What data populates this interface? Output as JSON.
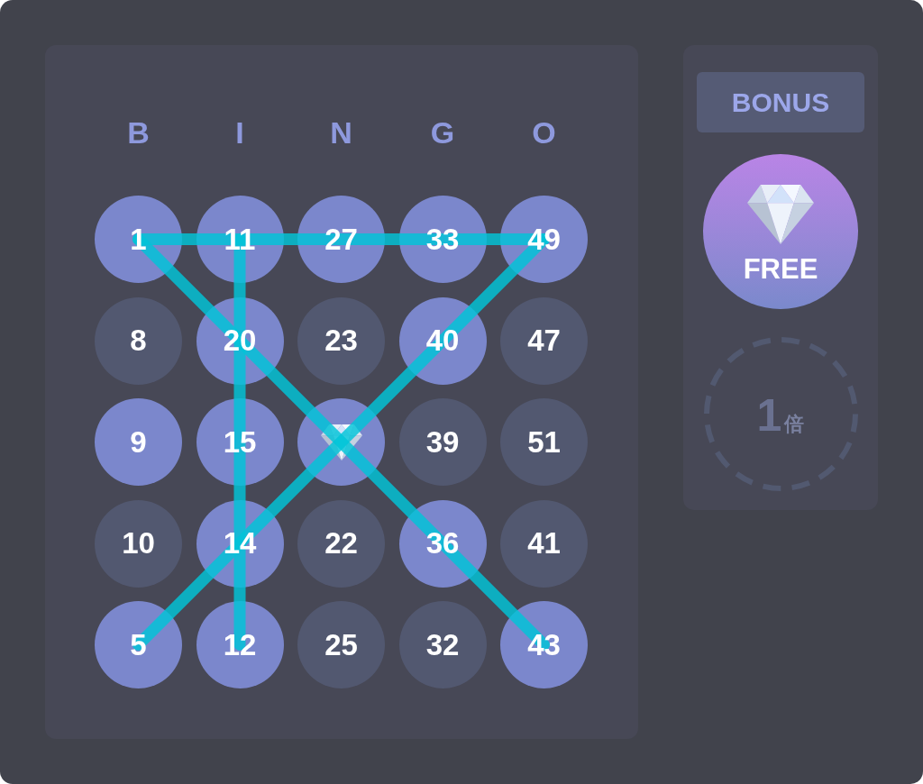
{
  "card": {
    "headers": [
      {
        "letter": "B",
        "struck": false
      },
      {
        "letter": "I",
        "struck": true
      },
      {
        "letter": "N",
        "struck": false
      },
      {
        "letter": "G",
        "struck": false
      },
      {
        "letter": "O",
        "struck": false
      }
    ],
    "rows": [
      {
        "struck": true,
        "cells": [
          {
            "kind": "number",
            "text": "1",
            "marked": true
          },
          {
            "kind": "number",
            "text": "11",
            "marked": true
          },
          {
            "kind": "number",
            "text": "27",
            "marked": true
          },
          {
            "kind": "number",
            "text": "33",
            "marked": true
          },
          {
            "kind": "number",
            "text": "49",
            "marked": true
          }
        ]
      },
      {
        "struck": false,
        "cells": [
          {
            "kind": "number",
            "text": "8",
            "marked": false
          },
          {
            "kind": "number",
            "text": "20",
            "marked": true
          },
          {
            "kind": "number",
            "text": "23",
            "marked": false
          },
          {
            "kind": "number",
            "text": "40",
            "marked": true
          },
          {
            "kind": "number",
            "text": "47",
            "marked": false
          }
        ]
      },
      {
        "struck": false,
        "cells": [
          {
            "kind": "number",
            "text": "9",
            "marked": true
          },
          {
            "kind": "number",
            "text": "15",
            "marked": true
          },
          {
            "kind": "free",
            "marked": true
          },
          {
            "kind": "number",
            "text": "39",
            "marked": false
          },
          {
            "kind": "number",
            "text": "51",
            "marked": false
          }
        ]
      },
      {
        "struck": false,
        "cells": [
          {
            "kind": "number",
            "text": "10",
            "marked": false
          },
          {
            "kind": "number",
            "text": "14",
            "marked": true
          },
          {
            "kind": "number",
            "text": "22",
            "marked": false
          },
          {
            "kind": "number",
            "text": "36",
            "marked": true
          },
          {
            "kind": "number",
            "text": "41",
            "marked": false
          }
        ]
      },
      {
        "struck": false,
        "cells": [
          {
            "kind": "number",
            "text": "5",
            "marked": true
          },
          {
            "kind": "number",
            "text": "12",
            "marked": true
          },
          {
            "kind": "number",
            "text": "25",
            "marked": false
          },
          {
            "kind": "number",
            "text": "32",
            "marked": false
          },
          {
            "kind": "number",
            "text": "43",
            "marked": true
          }
        ]
      }
    ],
    "diagonal_struck": true,
    "anti_diagonal_struck": true
  },
  "bonus": {
    "title": "BONUS",
    "slots": [
      {
        "kind": "free",
        "label": "FREE"
      },
      {
        "kind": "multiplier",
        "value": "1",
        "unit": "倍"
      }
    ]
  }
}
